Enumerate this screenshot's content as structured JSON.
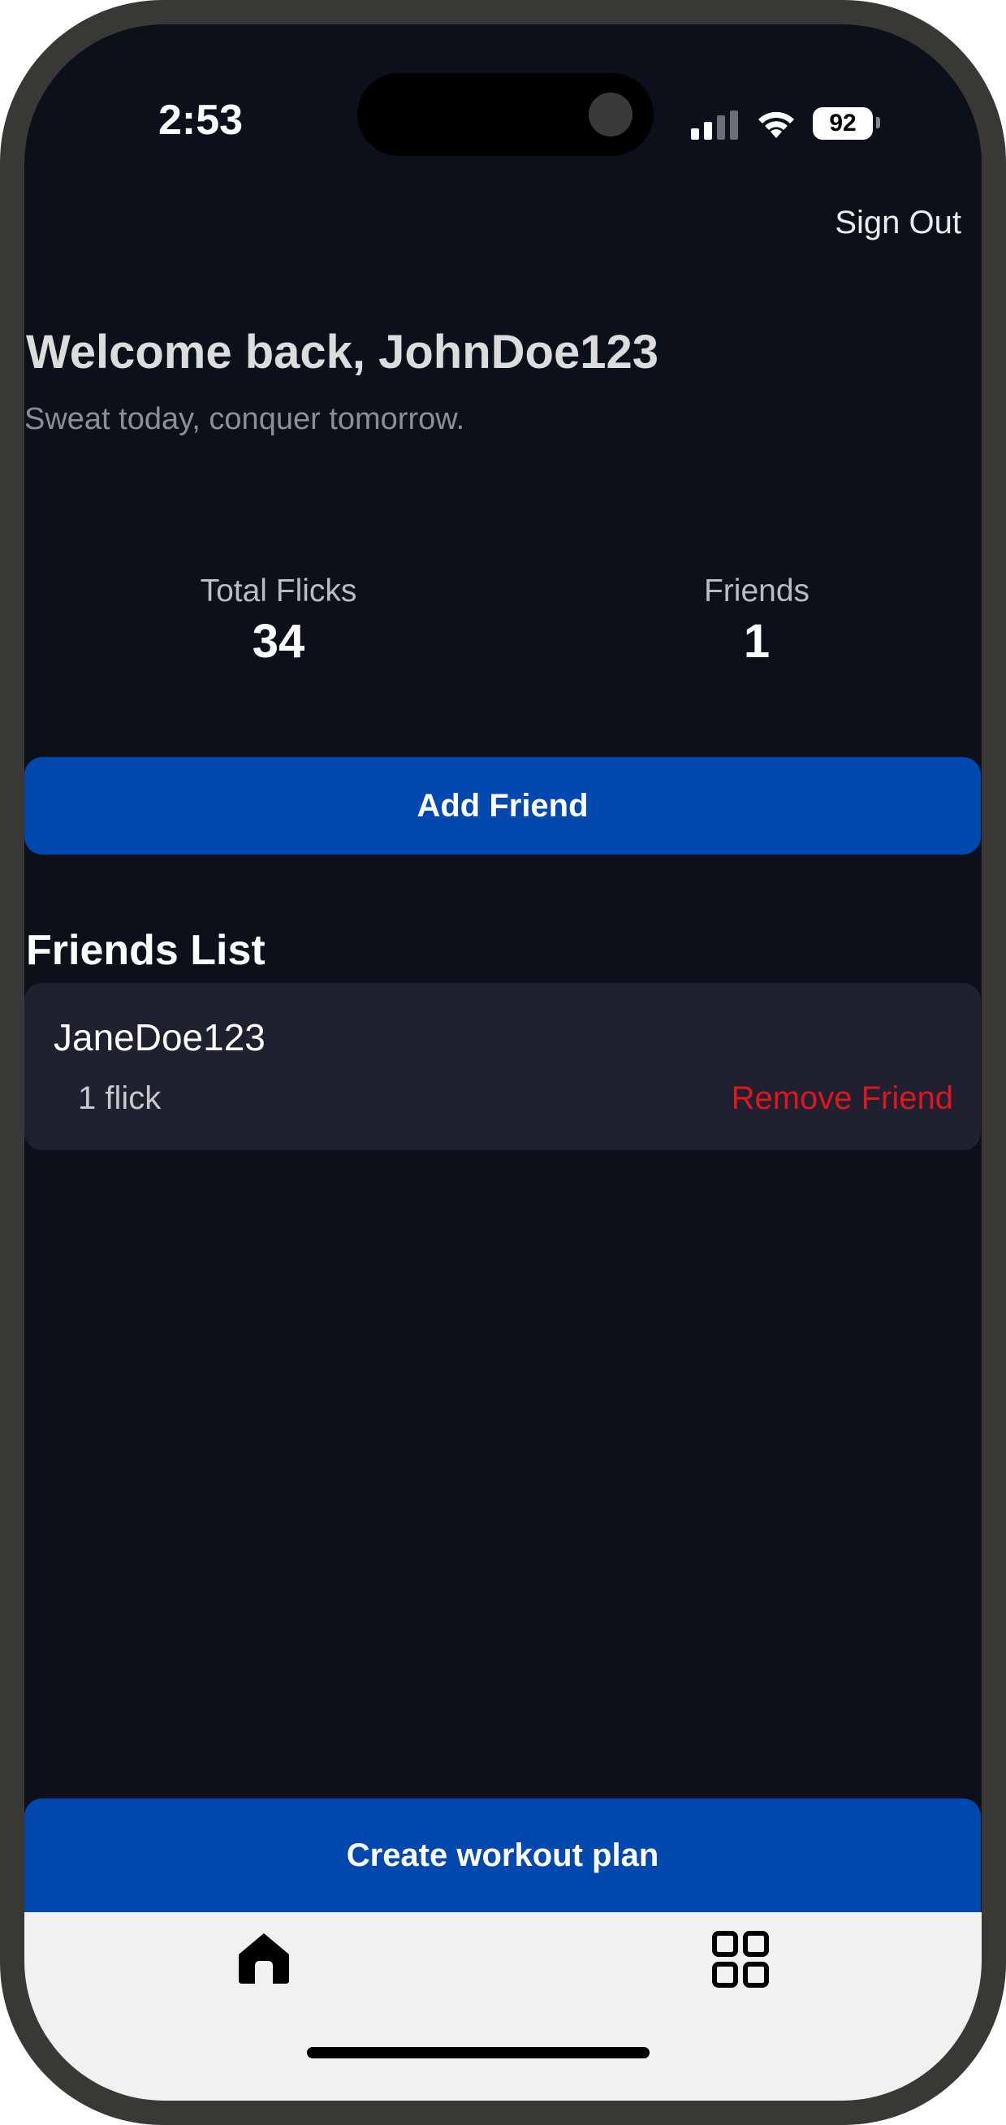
{
  "status_bar": {
    "time": "2:53",
    "battery": "92",
    "icons": [
      "signal-icon",
      "wifi-icon",
      "battery-icon"
    ]
  },
  "header": {
    "sign_out_label": "Sign Out"
  },
  "welcome": {
    "title": "Welcome back, JohnDoe123",
    "subtitle": "Sweat today, conquer tomorrow."
  },
  "stats": {
    "total_flicks_label": "Total Flicks",
    "total_flicks_value": "34",
    "friends_label": "Friends",
    "friends_value": "1"
  },
  "actions": {
    "add_friend_label": "Add Friend",
    "create_workout_label": "Create workout plan"
  },
  "friends_list": {
    "heading": "Friends List",
    "items": [
      {
        "name": "JaneDoe123",
        "flicks": "1 flick",
        "remove_label": "Remove Friend"
      }
    ]
  },
  "tab_bar": {
    "tabs": [
      {
        "icon": "home-icon"
      },
      {
        "icon": "grid-icon"
      }
    ]
  },
  "colors": {
    "background": "#0b101b",
    "accent": "#0048ad",
    "card": "#1f2030",
    "danger": "#e0161f",
    "tab_bar": "#f1f1f1"
  }
}
